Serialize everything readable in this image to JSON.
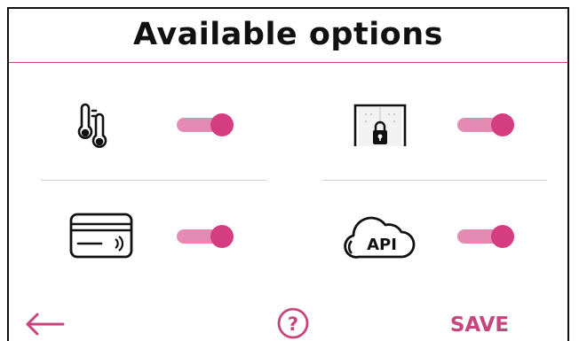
{
  "header": {
    "title": "Available options"
  },
  "options": [
    {
      "icon": "thermometer-icon",
      "enabled": true
    },
    {
      "icon": "door-lock-icon",
      "enabled": true
    },
    {
      "icon": "card-reader-icon",
      "enabled": true
    },
    {
      "icon": "cloud-api-icon",
      "icon_text": "API",
      "enabled": true
    }
  ],
  "footer": {
    "back_icon": "arrow-left-icon",
    "help_icon": "question-circle-icon",
    "help_glyph": "?",
    "save_label": "SAVE"
  },
  "colors": {
    "accent": "#c8447d",
    "toggle_track": "#e58ab2",
    "toggle_knob": "#d43d80",
    "text": "#111111",
    "divider": "#d2d2d2"
  }
}
